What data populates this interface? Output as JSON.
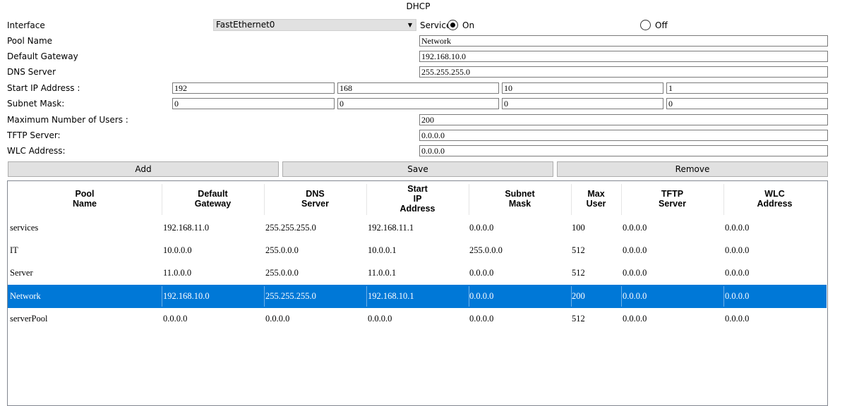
{
  "window": {
    "title": "DHCP"
  },
  "form": {
    "interface": {
      "label": "Interface",
      "value": "FastEthernet0"
    },
    "service": {
      "label": "Service",
      "on_label": "On",
      "off_label": "Off",
      "selected": "On"
    },
    "pool_name": {
      "label": "Pool Name",
      "value": "Network"
    },
    "default_gateway": {
      "label": "Default Gateway",
      "value": "192.168.10.0"
    },
    "dns_server": {
      "label": "DNS Server",
      "value": "255.255.255.0"
    },
    "start_ip": {
      "label": "Start IP Address :",
      "octets": [
        "192",
        "168",
        "10",
        "1"
      ]
    },
    "subnet_mask": {
      "label": "Subnet Mask:",
      "octets": [
        "0",
        "0",
        "0",
        "0"
      ]
    },
    "max_users": {
      "label": "Maximum Number of Users :",
      "value": "200"
    },
    "tftp_server": {
      "label": "TFTP Server:",
      "value": "0.0.0.0"
    },
    "wlc_address": {
      "label": "WLC Address:",
      "value": "0.0.0.0"
    }
  },
  "buttons": {
    "add": "Add",
    "save": "Save",
    "remove": "Remove"
  },
  "table": {
    "headers": [
      [
        "Pool",
        "Name"
      ],
      [
        "Default",
        "Gateway"
      ],
      [
        "DNS",
        "Server"
      ],
      [
        "Start",
        "IP",
        "Address"
      ],
      [
        "Subnet",
        "Mask"
      ],
      [
        "Max",
        "User"
      ],
      [
        "TFTP",
        "Server"
      ],
      [
        "WLC",
        "Address"
      ]
    ],
    "rows": [
      [
        "services",
        "192.168.11.0",
        "255.255.255.0",
        "192.168.11.1",
        "0.0.0.0",
        "100",
        "0.0.0.0",
        "0.0.0.0"
      ],
      [
        "IT",
        "10.0.0.0",
        "255.0.0.0",
        "10.0.0.1",
        "255.0.0.0",
        "512",
        "0.0.0.0",
        "0.0.0.0"
      ],
      [
        "Server",
        "11.0.0.0",
        "255.0.0.0",
        "11.0.0.1",
        "0.0.0.0",
        "512",
        "0.0.0.0",
        "0.0.0.0"
      ],
      [
        "Network",
        "192.168.10.0",
        "255.255.255.0",
        "192.168.10.1",
        "0.0.0.0",
        "200",
        "0.0.0.0",
        "0.0.0.0"
      ],
      [
        "serverPool",
        "0.0.0.0",
        "0.0.0.0",
        "0.0.0.0",
        "0.0.0.0",
        "512",
        "0.0.0.0",
        "0.0.0.0"
      ]
    ],
    "selected_row": 3
  },
  "colors": {
    "selection": "#0078d7",
    "button_bg": "#e1e1e1",
    "border": "#7a7a7a"
  }
}
